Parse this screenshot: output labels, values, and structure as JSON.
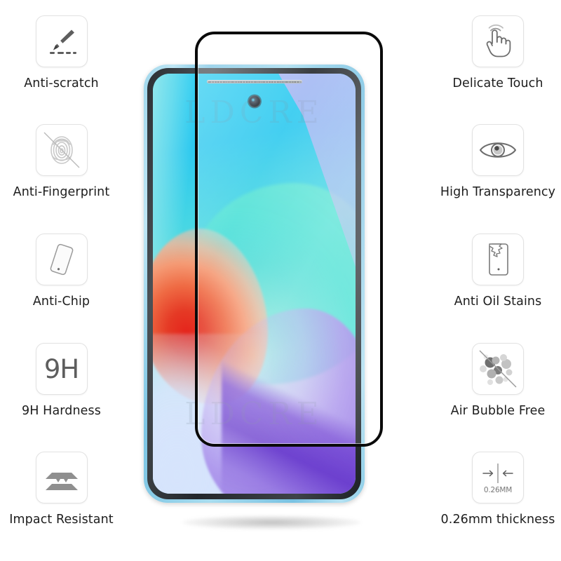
{
  "product": {
    "watermark_text": "LDCRE",
    "device_label": "smartphone-with-tempered-glass-protector"
  },
  "features_left": [
    {
      "icon": "knife-scratch-icon",
      "label": "Anti-scratch"
    },
    {
      "icon": "fingerprint-blocked-icon",
      "label": "Anti-Fingerprint"
    },
    {
      "icon": "phone-chip-corner-icon",
      "label": "Anti-Chip"
    },
    {
      "icon": "hardness-9h-icon",
      "label": "9H Hardness",
      "badge": "9H"
    },
    {
      "icon": "impact-layers-icon",
      "label": "Impact Resistant"
    }
  ],
  "features_right": [
    {
      "icon": "hand-touch-icon",
      "label": "Delicate Touch"
    },
    {
      "icon": "eye-icon",
      "label": "High Transparency"
    },
    {
      "icon": "phone-oil-stain-icon",
      "label": "Anti Oil Stains"
    },
    {
      "icon": "bubbles-blocked-icon",
      "label": "Air Bubble Free"
    },
    {
      "icon": "thickness-arrows-icon",
      "label": "0.26mm thickness",
      "badge": "0.26MM"
    }
  ],
  "colors": {
    "background": "#ffffff",
    "label_text": "#1d1d1d",
    "icon_stroke": "#6e6e6e",
    "icon_border": "#e2e2e2",
    "glass_edge": "#0a0a0a",
    "phone_frame": "#9fd7ec",
    "wallpaper_teal": "#3edcd8",
    "wallpaper_red": "#e5241c",
    "wallpaper_violet": "#7a4ed7"
  }
}
